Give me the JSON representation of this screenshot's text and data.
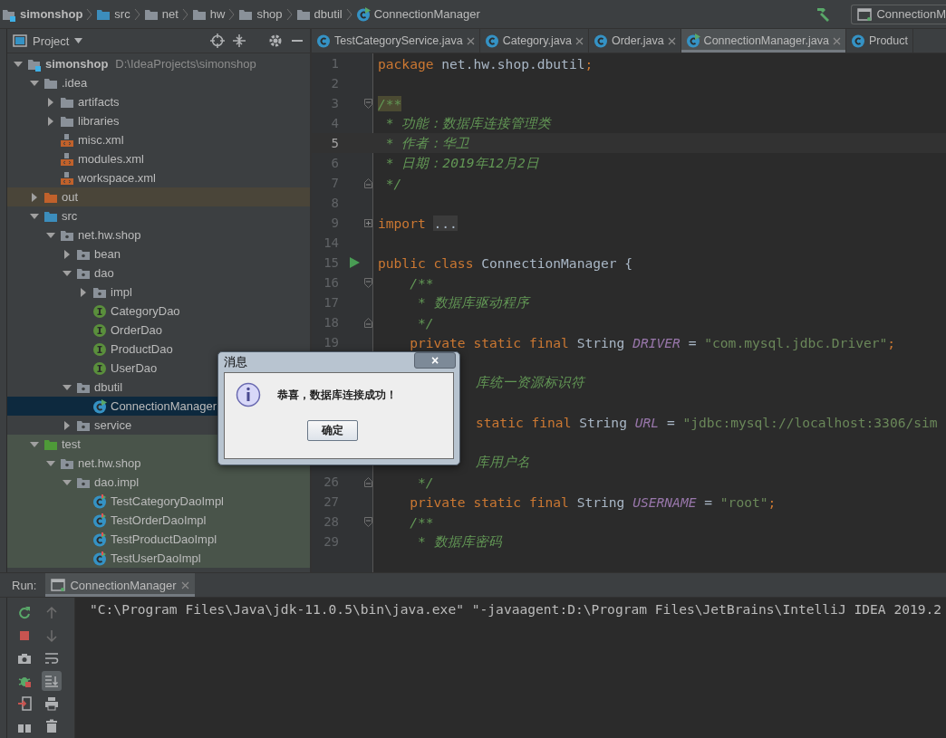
{
  "breadcrumbs": [
    {
      "label": "simonshop",
      "kind": "module"
    },
    {
      "label": "src",
      "kind": "source_folder"
    },
    {
      "label": "net",
      "kind": "folder"
    },
    {
      "label": "hw",
      "kind": "folder"
    },
    {
      "label": "shop",
      "kind": "folder"
    },
    {
      "label": "dbutil",
      "kind": "folder"
    },
    {
      "label": "ConnectionManager",
      "kind": "runnable_class"
    }
  ],
  "run_config": {
    "label": "ConnectionM"
  },
  "project_panel": {
    "title": "Project",
    "tree": [
      {
        "label": "simonshop",
        "path": "D:\\IdeaProjects\\simonshop",
        "kind": "module",
        "expanded": true,
        "selected": false,
        "children": [
          {
            "label": ".idea",
            "kind": "folder",
            "expanded": true,
            "selected": false,
            "children": [
              {
                "label": "artifacts",
                "kind": "folder",
                "expanded": false,
                "selected": false
              },
              {
                "label": "libraries",
                "kind": "folder",
                "expanded": false,
                "selected": false
              },
              {
                "label": "misc.xml",
                "kind": "xml",
                "selected": false
              },
              {
                "label": "modules.xml",
                "kind": "xml",
                "selected": false
              },
              {
                "label": "workspace.xml",
                "kind": "xml",
                "selected": false
              }
            ]
          },
          {
            "label": "out",
            "kind": "excluded_folder",
            "expanded": false,
            "selected": false
          },
          {
            "label": "src",
            "kind": "source_folder",
            "expanded": true,
            "selected": false,
            "children": [
              {
                "label": "net.hw.shop",
                "kind": "package",
                "expanded": true,
                "selected": false,
                "children": [
                  {
                    "label": "bean",
                    "kind": "package",
                    "expanded": false,
                    "selected": false
                  },
                  {
                    "label": "dao",
                    "kind": "package",
                    "expanded": true,
                    "selected": false,
                    "children": [
                      {
                        "label": "impl",
                        "kind": "package",
                        "expanded": false,
                        "selected": false
                      },
                      {
                        "label": "CategoryDao",
                        "kind": "interface",
                        "selected": false
                      },
                      {
                        "label": "OrderDao",
                        "kind": "interface",
                        "selected": false
                      },
                      {
                        "label": "ProductDao",
                        "kind": "interface",
                        "selected": false
                      },
                      {
                        "label": "UserDao",
                        "kind": "interface",
                        "selected": false
                      }
                    ]
                  },
                  {
                    "label": "dbutil",
                    "kind": "package",
                    "expanded": true,
                    "selected": false,
                    "children": [
                      {
                        "label": "ConnectionManager",
                        "kind": "runnable_class",
                        "selected": true
                      }
                    ]
                  },
                  {
                    "label": "service",
                    "kind": "package",
                    "expanded": false,
                    "selected": false
                  }
                ]
              }
            ]
          },
          {
            "label": "test",
            "kind": "test_folder",
            "expanded": true,
            "selected": false,
            "children": [
              {
                "label": "net.hw.shop",
                "kind": "package",
                "expanded": true,
                "selected": false,
                "children": [
                  {
                    "label": "dao.impl",
                    "kind": "package",
                    "expanded": true,
                    "selected": false,
                    "children": [
                      {
                        "label": "TestCategoryDaoImpl",
                        "kind": "test_class",
                        "selected": false
                      },
                      {
                        "label": "TestOrderDaoImpl",
                        "kind": "test_class",
                        "selected": false
                      },
                      {
                        "label": "TestProductDaoImpl",
                        "kind": "test_class",
                        "selected": false
                      },
                      {
                        "label": "TestUserDaoImpl",
                        "kind": "test_class",
                        "selected": false
                      }
                    ]
                  }
                ]
              }
            ]
          }
        ]
      }
    ]
  },
  "editor_tabs": [
    {
      "label": "TestCategoryService.java",
      "kind": "class",
      "selected": false,
      "closable": true
    },
    {
      "label": "Category.java",
      "kind": "class",
      "selected": false,
      "closable": true
    },
    {
      "label": "Order.java",
      "kind": "class",
      "selected": false,
      "closable": true
    },
    {
      "label": "ConnectionManager.java",
      "kind": "runnable_class",
      "selected": true,
      "closable": true
    },
    {
      "label": "Product",
      "kind": "class",
      "selected": false,
      "closable": false
    }
  ],
  "code_lines": [
    {
      "number": "1",
      "tokens": [
        {
          "kind": "keyword",
          "text": "package"
        },
        {
          "kind": "plain",
          "text": " net.hw.shop.dbutil"
        },
        {
          "kind": "keyword",
          "text": ";"
        }
      ]
    },
    {
      "number": "2"
    },
    {
      "number": "3",
      "fold": {
        "kind": "start"
      },
      "tokens": [
        {
          "kind": "doc",
          "text": "/**",
          "highlighted": true
        }
      ]
    },
    {
      "number": "4",
      "tokens": [
        {
          "kind": "doc",
          "text": " * 功能：数据库连接管理类"
        }
      ]
    },
    {
      "number": "5",
      "current": true,
      "tokens": [
        {
          "kind": "doc",
          "text": " * 作者：华卫"
        }
      ]
    },
    {
      "number": "6",
      "tokens": [
        {
          "kind": "doc",
          "text": " * 日期：2019年12月2日"
        }
      ]
    },
    {
      "number": "7",
      "fold": {
        "kind": "end"
      },
      "tokens": [
        {
          "kind": "doc",
          "text": " */"
        }
      ]
    },
    {
      "number": "8"
    },
    {
      "number": "9",
      "fold": {
        "kind": "collapsed"
      },
      "tokens": [
        {
          "kind": "keyword",
          "text": "import"
        },
        {
          "kind": "folded",
          "text": "..."
        }
      ]
    },
    {
      "number": "14"
    },
    {
      "number": "15",
      "run": true,
      "tokens": [
        {
          "kind": "keyword",
          "text": "public class"
        },
        {
          "kind": "plain",
          "text": " ConnectionManager {"
        }
      ]
    },
    {
      "number": "16",
      "fold": {
        "kind": "start"
      },
      "tokens": [
        {
          "kind": "doc",
          "text": "    /**"
        }
      ]
    },
    {
      "number": "17",
      "tokens": [
        {
          "kind": "doc",
          "text": "     * 数据库驱动程序"
        }
      ]
    },
    {
      "number": "18",
      "fold": {
        "kind": "end"
      },
      "tokens": [
        {
          "kind": "doc",
          "text": "     */"
        }
      ]
    },
    {
      "number": "19",
      "tokens": [
        {
          "kind": "keyword",
          "text": "    private static final"
        },
        {
          "kind": "plain",
          "text": " String "
        },
        {
          "kind": "constant",
          "text": "DRIVER"
        },
        {
          "kind": "plain",
          "text": " = "
        },
        {
          "kind": "string",
          "text": "\"com.mysql.jdbc.Driver\""
        },
        {
          "kind": "keyword",
          "text": ";"
        }
      ]
    },
    {
      "covered": true,
      "gap_before": true,
      "tokens": [
        {
          "kind": "doc",
          "text": "库统一资源标识符"
        }
      ]
    },
    {
      "covered": true,
      "gap_before": true,
      "tokens": [
        {
          "kind": "keyword",
          "text": "static final"
        },
        {
          "kind": "plain",
          "text": " String "
        },
        {
          "kind": "constant",
          "text": "URL"
        },
        {
          "kind": "plain",
          "text": " = "
        },
        {
          "kind": "string",
          "text": "\"jdbc:mysql://localhost:3306/sim"
        }
      ]
    },
    {
      "covered": true,
      "gap_before": true,
      "tokens": [
        {
          "kind": "doc",
          "text": "库用户名"
        }
      ]
    },
    {
      "number": "26",
      "fold": {
        "kind": "end"
      },
      "tokens": [
        {
          "kind": "doc",
          "text": "     */"
        }
      ]
    },
    {
      "number": "27",
      "tokens": [
        {
          "kind": "keyword",
          "text": "    private static final"
        },
        {
          "kind": "plain",
          "text": " String "
        },
        {
          "kind": "constant",
          "text": "USERNAME"
        },
        {
          "kind": "plain",
          "text": " = "
        },
        {
          "kind": "string",
          "text": "\"root\""
        },
        {
          "kind": "keyword",
          "text": ";"
        }
      ]
    },
    {
      "number": "28",
      "fold": {
        "kind": "start"
      },
      "tokens": [
        {
          "kind": "doc",
          "text": "    /**"
        }
      ]
    },
    {
      "number": "29",
      "tokens": [
        {
          "kind": "doc",
          "text": "     * 数据库密码"
        }
      ]
    }
  ],
  "run_panel": {
    "label": "Run:",
    "tab": {
      "label": "ConnectionManager",
      "selected": true
    },
    "console_lines": [
      "\"C:\\Program Files\\Java\\jdk-11.0.5\\bin\\java.exe\" \"-javaagent:D:\\Program Files\\JetBrains\\IntelliJ IDEA 2019.2"
    ],
    "tools": [
      {
        "kind": "rerun",
        "selected": false
      },
      {
        "kind": "up",
        "selected": false
      },
      {
        "kind": "stop",
        "selected": false
      },
      {
        "kind": "down",
        "selected": false
      },
      {
        "kind": "camera",
        "selected": false
      },
      {
        "kind": "wrap",
        "selected": false
      },
      {
        "kind": "debug",
        "selected": false
      },
      {
        "kind": "scroll_end",
        "selected": true
      },
      {
        "kind": "exit",
        "selected": false
      },
      {
        "kind": "print",
        "selected": false
      },
      {
        "kind": "layout",
        "selected": false
      },
      {
        "kind": "trash",
        "selected": false
      }
    ]
  },
  "dialog": {
    "title": "消息",
    "close": "×",
    "message": "恭喜，数据库连接成功！",
    "button": "确定"
  }
}
